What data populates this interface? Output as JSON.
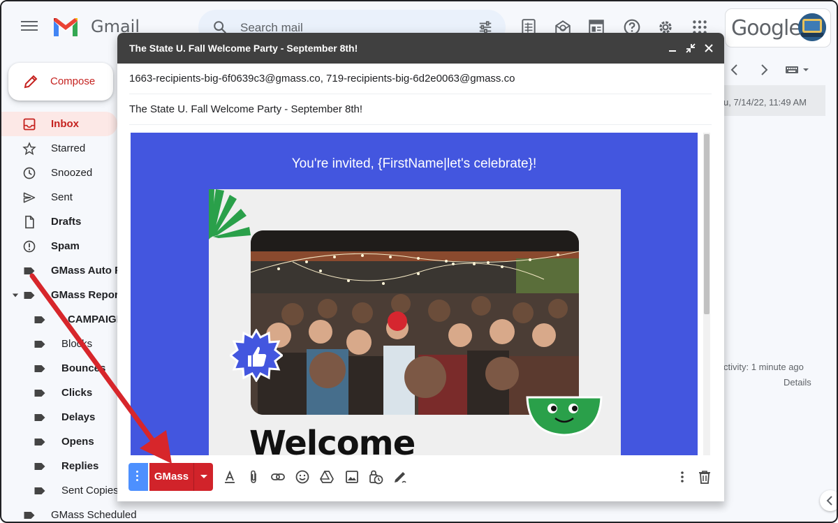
{
  "header": {
    "app_name": "Gmail",
    "search_placeholder": "Search mail",
    "google_label": "Google"
  },
  "sidebar": {
    "compose_label": "Compose",
    "items": [
      {
        "label": "Inbox",
        "icon": "inbox-icon"
      },
      {
        "label": "Starred",
        "icon": "star-icon"
      },
      {
        "label": "Snoozed",
        "icon": "clock-icon"
      },
      {
        "label": "Sent",
        "icon": "send-icon"
      },
      {
        "label": "Drafts",
        "icon": "draft-icon"
      },
      {
        "label": "Spam",
        "icon": "spam-icon"
      },
      {
        "label": "GMass Auto F",
        "icon": "label-icon"
      },
      {
        "label": "GMass Repor",
        "icon": "label-icon"
      },
      {
        "label": "CAMPAIGN",
        "icon": "label-icon"
      },
      {
        "label": "Blocks",
        "icon": "label-icon"
      },
      {
        "label": "Bounces",
        "icon": "label-icon"
      },
      {
        "label": "Clicks",
        "icon": "label-icon"
      },
      {
        "label": "Delays",
        "icon": "label-icon"
      },
      {
        "label": "Opens",
        "icon": "label-icon"
      },
      {
        "label": "Replies",
        "icon": "label-icon"
      },
      {
        "label": "Sent Copies",
        "icon": "label-icon"
      },
      {
        "label": "GMass Scheduled",
        "icon": "label-icon"
      }
    ]
  },
  "background": {
    "date": "u, 7/14/22, 11:49 AM",
    "activity": "ctivity: 1 minute ago",
    "details": "Details"
  },
  "compose": {
    "title": "The State U. Fall Welcome Party - September 8th!",
    "to": "1663-recipients-big-6f0639c3@gmass.co, 719-recipients-big-6d2e0063@gmass.co",
    "subject": "The State U. Fall Welcome Party - September 8th!",
    "body": {
      "invite": "You're invited, {FirstName|let's celebrate}!",
      "welcome": "Welcome"
    },
    "toolbar": {
      "gmass_label": "GMass"
    }
  },
  "colors": {
    "gmail_red": "#c5221f",
    "gmass_red": "#d1232a",
    "email_blue": "#4356df",
    "compose_header": "#404040",
    "arrow_red": "#d7262b"
  }
}
